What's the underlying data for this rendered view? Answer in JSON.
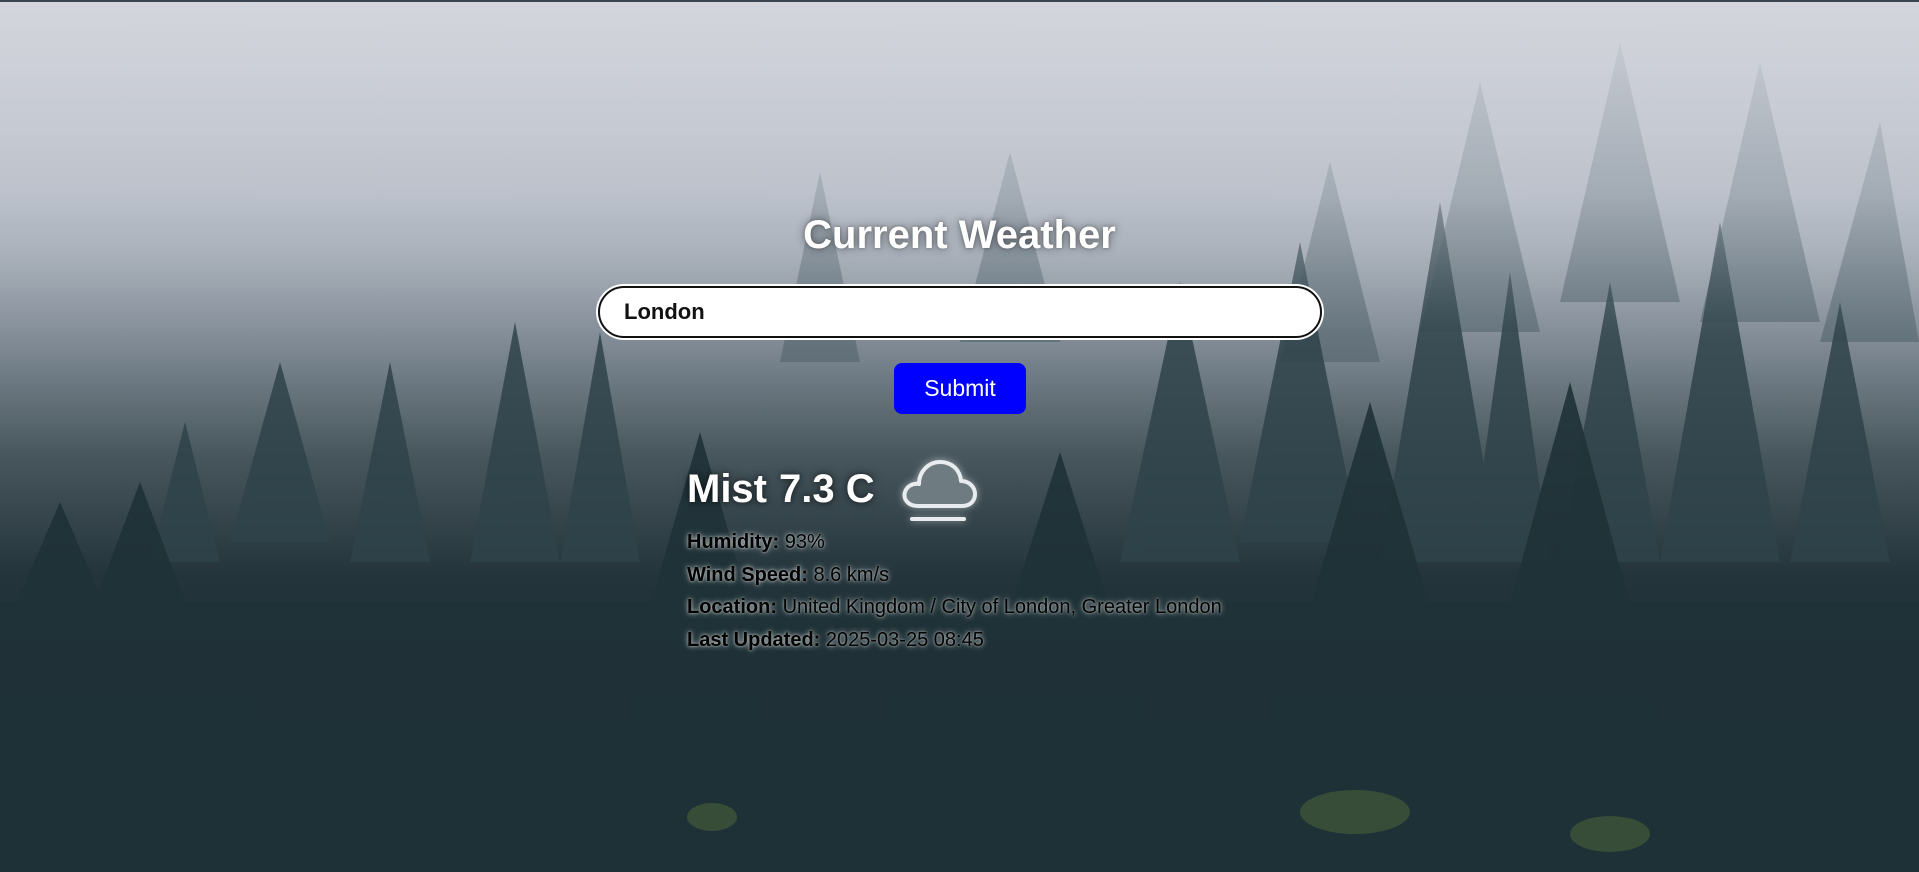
{
  "header": {
    "title": "Current Weather"
  },
  "search": {
    "value": "London"
  },
  "submit": {
    "label": "Submit"
  },
  "current": {
    "condition": "Mist",
    "temperature": "7.3 C",
    "icon": "cloud-icon"
  },
  "details": [
    {
      "label": "Humidity:",
      "value": "93%"
    },
    {
      "label": "Wind Speed:",
      "value": "8.6 km/s"
    },
    {
      "label": "Location:",
      "value": "United Kingdom / City of London, Greater London"
    },
    {
      "label": "Last Updated:",
      "value": "2025-03-25 08:45"
    }
  ],
  "colors": {
    "submit_bg": "#0000ff",
    "title": "#ffffff",
    "background_top": "#cdd0d8",
    "background_bottom": "#18282c"
  }
}
